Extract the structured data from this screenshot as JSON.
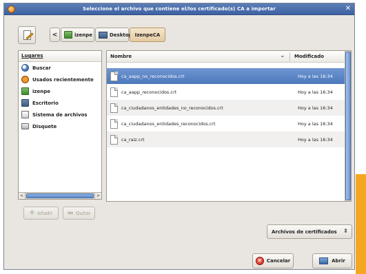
{
  "window": {
    "title": "Seleccione el archivo que contiene el/los certificado(s) CA a importar",
    "close_glyph": "✕"
  },
  "path_bar": {
    "left_arrow": "<",
    "crumbs": [
      "izenpe",
      "Desktop",
      "IzenpeCA"
    ]
  },
  "places": {
    "header": "Lugares",
    "items": [
      {
        "label": "Buscar",
        "icon": "search-icon"
      },
      {
        "label": "Usados recientemente",
        "icon": "recent-icon"
      },
      {
        "label": "izenpe",
        "icon": "home-folder-icon"
      },
      {
        "label": "Escritorio",
        "icon": "desktop-icon"
      },
      {
        "label": "Sistema de archivos",
        "icon": "filesystem-icon"
      },
      {
        "label": "Disquete",
        "icon": "floppy-icon"
      }
    ],
    "scroll_left": "<",
    "scroll_right": ">"
  },
  "buttons": {
    "add": "Añadir",
    "remove": "Quitar",
    "cancel": "Cancelar",
    "open": "Abrir"
  },
  "files": {
    "columns": {
      "name": "Nombre",
      "modified": "Modificado"
    },
    "rows": [
      {
        "name": "ca_aapp_no_reconocidos.crt",
        "modified": "Hoy a las 16:34",
        "selected": true
      },
      {
        "name": "ca_aapp_reconocidos.crt",
        "modified": "Hoy a las 16:34",
        "selected": false
      },
      {
        "name": "ca_ciudadanos_entidades_no_reconocidos.crt",
        "modified": "Hoy a las 16:34",
        "selected": false
      },
      {
        "name": "ca_ciudadanos_entidades_reconocidos.crt",
        "modified": "Hoy a las 16:34",
        "selected": false
      },
      {
        "name": "ca_raiz.crt",
        "modified": "Hoy a las 16:34",
        "selected": false
      }
    ]
  },
  "filter": {
    "selected": "Archivos de certificados"
  },
  "colors": {
    "selection": "#5a84c4",
    "titlebar": "#4a6fae",
    "accent_strip": "#f5a623"
  }
}
